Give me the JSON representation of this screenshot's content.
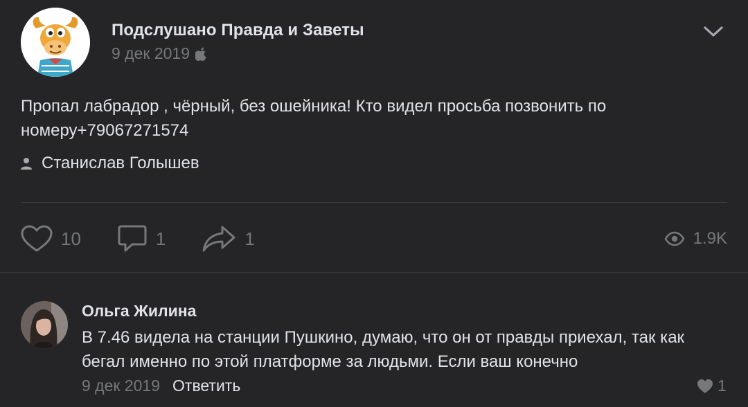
{
  "post": {
    "group_name": "Подслушано Правда и Заветы",
    "date": "9 дек 2019",
    "platform_icon": "apple-icon",
    "text": "Пропал лабрадор , чёрный, без ошейника! Кто видел просьба позвонить по номеру+79067271574",
    "signer": "Станислав Голышев",
    "likes": "10",
    "comments": "1",
    "shares": "1",
    "views": "1.9K"
  },
  "comment": {
    "author": "Ольга Жилина",
    "text": "В 7.46 видела на станции Пушкино, думаю, что он от правды приехал, так как бегал именно по этой платформе за людьми. Если ваш конечно",
    "date": "9 дек 2019",
    "reply_label": "Ответить",
    "likes": "1"
  },
  "colors": {
    "background": "#252527",
    "text": "#e1e3e6",
    "secondary": "#76787a",
    "divider": "#3a3a3c"
  }
}
